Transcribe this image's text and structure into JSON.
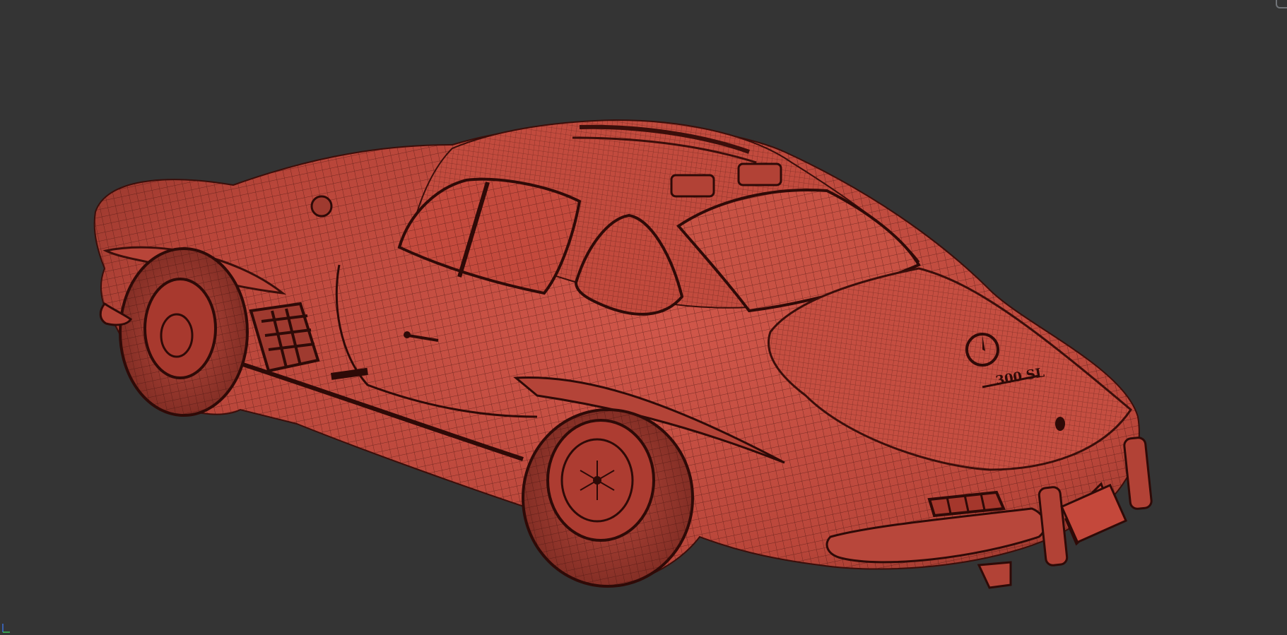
{
  "viewport": {
    "background": "#343434",
    "mesh_color": "#c0493c",
    "wire_color": "#3a0e0a",
    "model": {
      "badge_text": "300 SL"
    }
  }
}
